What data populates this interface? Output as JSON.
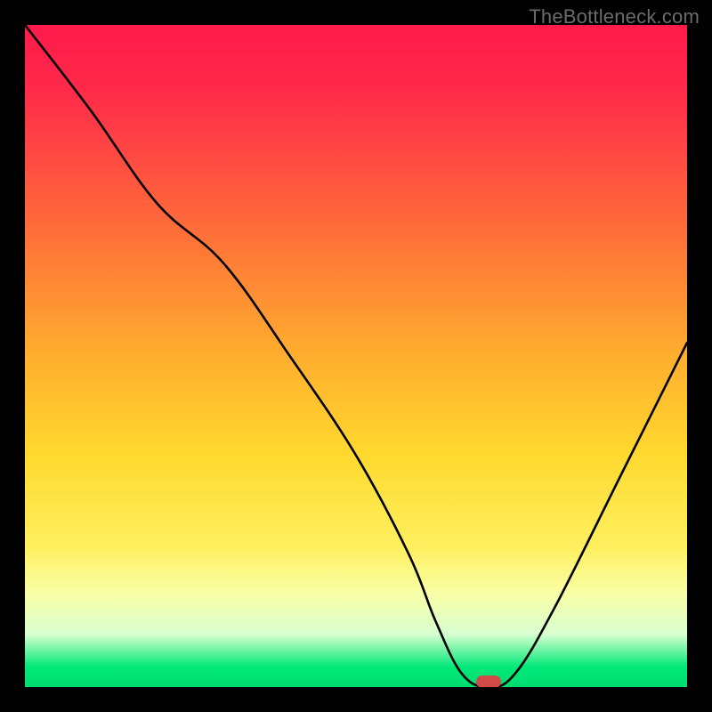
{
  "watermark": "TheBottleneck.com",
  "chart_data": {
    "type": "line",
    "title": "",
    "xlabel": "",
    "ylabel": "",
    "xlim": [
      0,
      100
    ],
    "ylim": [
      0,
      100
    ],
    "grid": false,
    "legend": false,
    "series": [
      {
        "name": "bottleneck-curve",
        "x": [
          0,
          10,
          20,
          30,
          40,
          50,
          58,
          62,
          66,
          70,
          74,
          80,
          90,
          100
        ],
        "y": [
          100,
          87,
          73,
          64,
          50,
          35,
          20,
          10,
          2,
          0,
          2,
          12,
          32,
          52
        ]
      }
    ],
    "marker": {
      "x": 70,
      "y": 0,
      "color": "#d14a4a"
    },
    "gradient_stops": [
      {
        "pct": 0,
        "color": "#ff1a4a"
      },
      {
        "pct": 30,
        "color": "#ff6a3a"
      },
      {
        "pct": 50,
        "color": "#ffae2e"
      },
      {
        "pct": 65,
        "color": "#ffd92e"
      },
      {
        "pct": 86,
        "color": "#f8ffa8"
      },
      {
        "pct": 97,
        "color": "#00e878"
      },
      {
        "pct": 100,
        "color": "#00de70"
      }
    ]
  }
}
